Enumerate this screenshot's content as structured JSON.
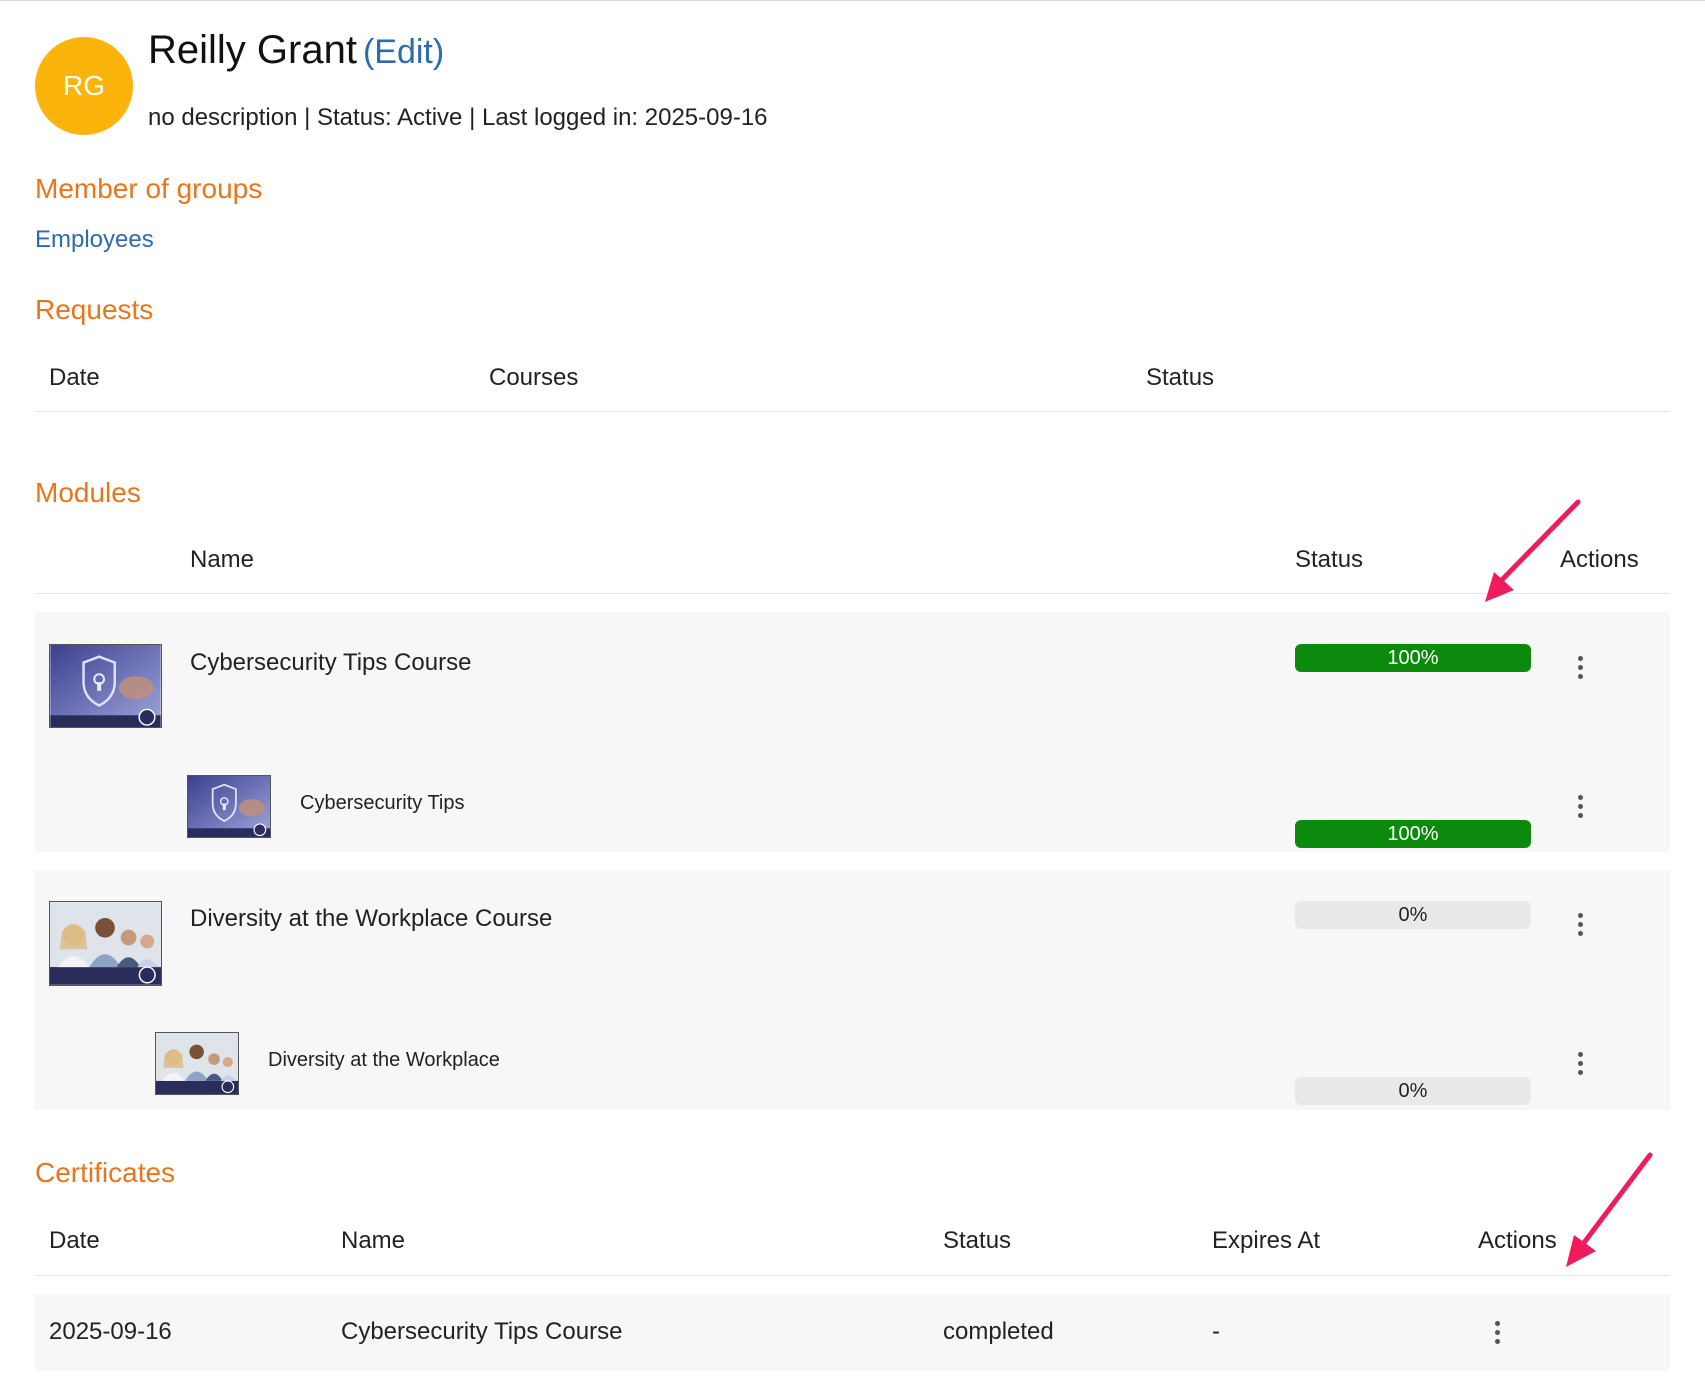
{
  "user": {
    "initials": "RG",
    "name": "Reilly Grant",
    "edit_label": "(Edit)",
    "meta": "no description | Status: Active | Last logged in: 2025-09-16"
  },
  "groups": {
    "title": "Member of groups",
    "items": [
      "Employees"
    ]
  },
  "requests": {
    "title": "Requests",
    "columns": [
      "Date",
      "Courses",
      "Status"
    ]
  },
  "modules": {
    "title": "Modules",
    "columns": {
      "name": "Name",
      "status": "Status",
      "actions": "Actions"
    },
    "items": [
      {
        "name": "Cybersecurity Tips Course",
        "progress": 100,
        "progress_label": "100%",
        "thumbnail": "cybersecurity-thumbnail",
        "children": [
          {
            "name": "Cybersecurity Tips",
            "progress": 100,
            "progress_label": "100%",
            "thumbnail": "cybersecurity-thumbnail"
          }
        ]
      },
      {
        "name": "Diversity at the Workplace Course",
        "progress": 0,
        "progress_label": "0%",
        "thumbnail": "diversity-thumbnail",
        "children": [
          {
            "name": "Diversity at the Workplace",
            "progress": 0,
            "progress_label": "0%",
            "thumbnail": "diversity-thumbnail"
          }
        ]
      }
    ]
  },
  "certificates": {
    "title": "Certificates",
    "columns": {
      "date": "Date",
      "name": "Name",
      "status": "Status",
      "expires": "Expires At",
      "actions": "Actions"
    },
    "rows": [
      {
        "date": "2025-09-16",
        "name": "Cybersecurity Tips Course",
        "status": "completed",
        "expires": "-"
      }
    ]
  },
  "colors": {
    "accent": "#e8761c",
    "link": "#2e6bad",
    "avatar": "#fbb40c",
    "progress_complete": "#0b8a0b",
    "annotation_arrow": "#ee1c5c"
  },
  "icons": [
    "kebab-menu-icon",
    "annotation-arrow-icon"
  ]
}
